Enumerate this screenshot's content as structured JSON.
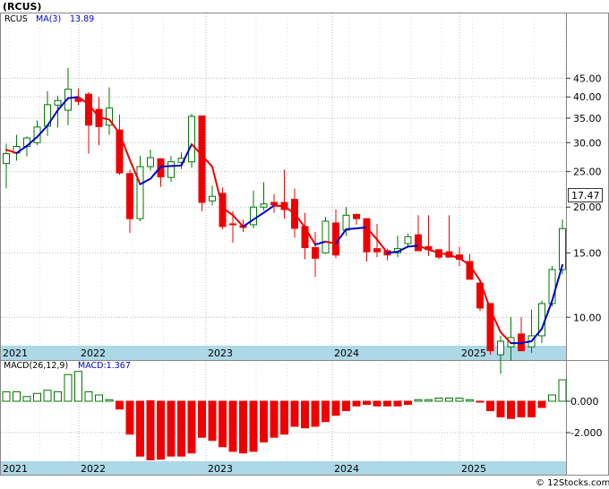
{
  "header": {
    "ticker": "(RCUS)",
    "price_legend": {
      "symbol": "RCUS",
      "ma_label": "MA(3)",
      "ma_value": "13.89"
    },
    "macd_legend": {
      "label": "MACD(26,12,9)",
      "value_label": "MACD:1.367"
    },
    "last_price": "17.47",
    "credit": "© 12Stocks.com"
  },
  "colors": {
    "up": "#007700",
    "down": "#ee0000",
    "ma_up": "#0000cc",
    "ma_down": "#ee0000",
    "axis_band": "#add8e6",
    "grid": "#b8b8b8"
  },
  "chart_data": [
    {
      "type": "candlestick",
      "title": "(RCUS)",
      "scale": "log",
      "y_ticks": [
        10.0,
        15.0,
        20.0,
        25.0,
        30.0,
        35.0,
        40.0,
        45.0
      ],
      "y_tick_labels": [
        "10.00",
        "15.00",
        "20.00",
        "25.00",
        "30.00",
        "35.00",
        "40.00",
        "45.00"
      ],
      "ylim": [
        7.0,
        50.0
      ],
      "x_year_labels": [
        "2021",
        "2022",
        "2023",
        "2024",
        "2025"
      ],
      "grid": true,
      "series": [
        {
          "name": "RCUS",
          "ohlc": [
            [
              26.3,
              29.8,
              22.5,
              28.0
            ],
            [
              28.1,
              31.5,
              26.8,
              29.3
            ],
            [
              29.3,
              31.2,
              27.5,
              30.9
            ],
            [
              30.0,
              34.5,
              29.5,
              33.1
            ],
            [
              33.3,
              41.5,
              31.3,
              38.1
            ],
            [
              38.0,
              40.3,
              33.0,
              39.1
            ],
            [
              36.8,
              48.0,
              33.5,
              42.0
            ],
            [
              39.6,
              42.2,
              38.0,
              38.9
            ],
            [
              40.7,
              41.2,
              28.0,
              33.5
            ],
            [
              37.0,
              40.0,
              29.5,
              33.2
            ],
            [
              33.5,
              42.5,
              31.5,
              37.3
            ],
            [
              32.5,
              35.8,
              24.5,
              24.8
            ],
            [
              24.7,
              25.3,
              17.0,
              18.6
            ],
            [
              18.6,
              27.6,
              18.3,
              25.8
            ],
            [
              25.8,
              28.7,
              25.2,
              27.3
            ],
            [
              27.1,
              27.2,
              22.7,
              24.2
            ],
            [
              24.1,
              27.6,
              23.4,
              26.6
            ],
            [
              26.5,
              28.2,
              25.4,
              27.2
            ],
            [
              26.6,
              36.0,
              25.6,
              35.4
            ],
            [
              35.5,
              35.5,
              19.5,
              20.6
            ],
            [
              20.8,
              22.9,
              20.2,
              21.4
            ],
            [
              21.8,
              22.6,
              17.4,
              17.7
            ],
            [
              18.0,
              19.5,
              16.0,
              17.9
            ],
            [
              17.8,
              18.5,
              17.1,
              17.6
            ],
            [
              17.9,
              22.2,
              17.5,
              20.0
            ],
            [
              20.0,
              23.4,
              19.6,
              20.4
            ],
            [
              20.6,
              21.7,
              19.3,
              20.3
            ],
            [
              20.6,
              25.3,
              18.6,
              19.7
            ],
            [
              21.0,
              22.5,
              16.5,
              17.5
            ],
            [
              17.7,
              19.3,
              14.4,
              15.5
            ],
            [
              15.5,
              17.1,
              12.9,
              14.5
            ],
            [
              15.0,
              18.8,
              14.9,
              18.3
            ],
            [
              18.1,
              19.7,
              14.5,
              14.8
            ],
            [
              17.3,
              20.0,
              16.7,
              19.0
            ],
            [
              19.1,
              19.2,
              17.9,
              18.6
            ],
            [
              18.6,
              18.6,
              14.2,
              15.1
            ],
            [
              15.4,
              18.0,
              14.6,
              15.1
            ],
            [
              15.2,
              15.4,
              14.3,
              14.8
            ],
            [
              15.0,
              16.7,
              14.6,
              15.4
            ],
            [
              15.9,
              16.9,
              15.5,
              16.6
            ],
            [
              16.8,
              19.0,
              15.3,
              15.2
            ],
            [
              15.6,
              19.0,
              14.7,
              15.3
            ],
            [
              15.3,
              15.3,
              14.4,
              14.6
            ],
            [
              15.1,
              19.0,
              14.6,
              14.6
            ],
            [
              14.8,
              15.6,
              13.8,
              14.4
            ],
            [
              14.2,
              14.9,
              12.7,
              12.7
            ],
            [
              12.4,
              12.5,
              10.4,
              10.6
            ],
            [
              10.9,
              10.9,
              7.9,
              8.1
            ],
            [
              7.9,
              8.9,
              7.0,
              8.6
            ],
            [
              8.3,
              10.0,
              7.6,
              8.8
            ],
            [
              9.0,
              10.0,
              8.1,
              8.1
            ],
            [
              8.3,
              10.5,
              8.0,
              8.9
            ],
            [
              8.9,
              11.1,
              8.5,
              10.9
            ],
            [
              10.9,
              13.8,
              10.7,
              13.5
            ],
            [
              13.5,
              18.5,
              13.1,
              17.47
            ]
          ]
        },
        {
          "name": "MA(3)",
          "values": [
            28.7,
            28.1,
            29.4,
            31.1,
            33.4,
            36.8,
            39.7,
            40.0,
            38.2,
            35.2,
            34.7,
            31.8,
            26.9,
            23.1,
            23.9,
            25.8,
            25.9,
            26.0,
            29.7,
            27.7,
            25.8,
            19.9,
            19.0,
            17.7,
            18.5,
            19.3,
            20.2,
            20.1,
            19.2,
            17.6,
            15.8,
            16.1,
            15.9,
            17.4,
            17.5,
            17.6,
            16.3,
            15.0,
            15.1,
            15.6,
            15.7,
            15.3,
            15.0,
            14.8,
            14.5,
            13.9,
            12.6,
            10.5,
            9.1,
            8.5,
            8.5,
            8.6,
            9.3,
            11.1,
            13.9
          ]
        }
      ]
    },
    {
      "type": "bar",
      "title": "MACD(26,12,9)",
      "y_ticks": [
        0.0,
        -2.0
      ],
      "y_tick_labels": [
        "0.000",
        "-2.000"
      ],
      "ylim": [
        -3.8,
        2.1
      ],
      "x_year_labels": [
        "2021",
        "2022",
        "2023",
        "2024",
        "2025"
      ],
      "grid": true,
      "series": [
        {
          "name": "MACD:1.367",
          "values": [
            0.6,
            0.6,
            0.3,
            0.5,
            0.7,
            0.6,
            1.7,
            1.9,
            0.6,
            0.4,
            0.1,
            -0.5,
            -2.1,
            -3.5,
            -3.8,
            -3.7,
            -3.5,
            -3.5,
            -3.3,
            -2.3,
            -2.5,
            -2.9,
            -3.2,
            -3.3,
            -3.2,
            -2.6,
            -2.3,
            -2.1,
            -1.6,
            -1.7,
            -1.6,
            -1.3,
            -0.9,
            -0.6,
            -0.3,
            -0.2,
            -0.3,
            -0.3,
            -0.3,
            -0.2,
            0.1,
            0.1,
            0.2,
            0.2,
            0.2,
            0.1,
            -0.05,
            -0.6,
            -1.0,
            -1.1,
            -1.0,
            -1.0,
            -0.4,
            0.4,
            1.367
          ]
        }
      ]
    }
  ]
}
